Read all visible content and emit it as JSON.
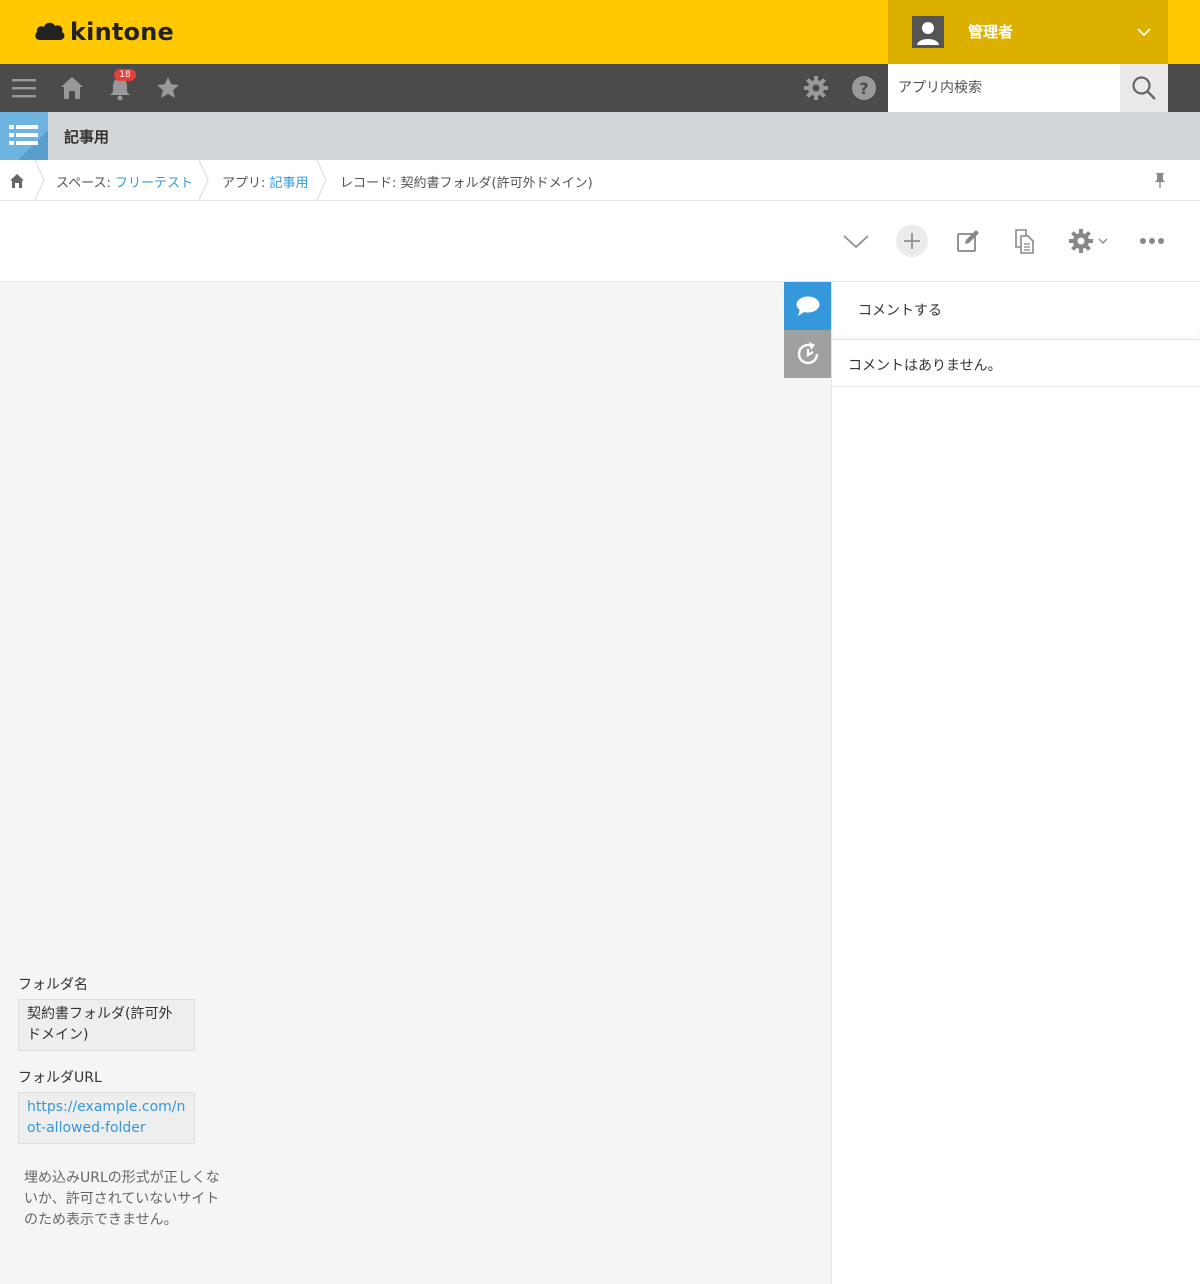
{
  "header": {
    "logo_text": "kintone",
    "user_name": "管理者"
  },
  "navbar": {
    "notification_count": "18",
    "search_placeholder": "アプリ内検索"
  },
  "app": {
    "title": "記事用"
  },
  "breadcrumb": {
    "space_prefix": "スペース: ",
    "space_name": "フリーテスト",
    "app_prefix": "アプリ: ",
    "app_name": "記事用",
    "record_label": "レコード: 契約書フォルダ(許可外ドメイン)"
  },
  "record": {
    "fields": [
      {
        "label": "フォルダ名",
        "value": "契約書フォルダ(許可外ドメイン)"
      },
      {
        "label": "フォルダURL",
        "value": "https://example.com/not-allowed-folder"
      }
    ],
    "embed_message": "埋め込みURLの形式が正しくないか、許可されていないサイトのため表示できません。"
  },
  "comments": {
    "input_placeholder": "コメントする",
    "empty_text": "コメントはありません。"
  },
  "colors": {
    "header": "#ffc800",
    "user_menu": "#ddb000",
    "navbar": "#4b4b4b",
    "link": "#3498db",
    "badge": "#e3413a"
  }
}
